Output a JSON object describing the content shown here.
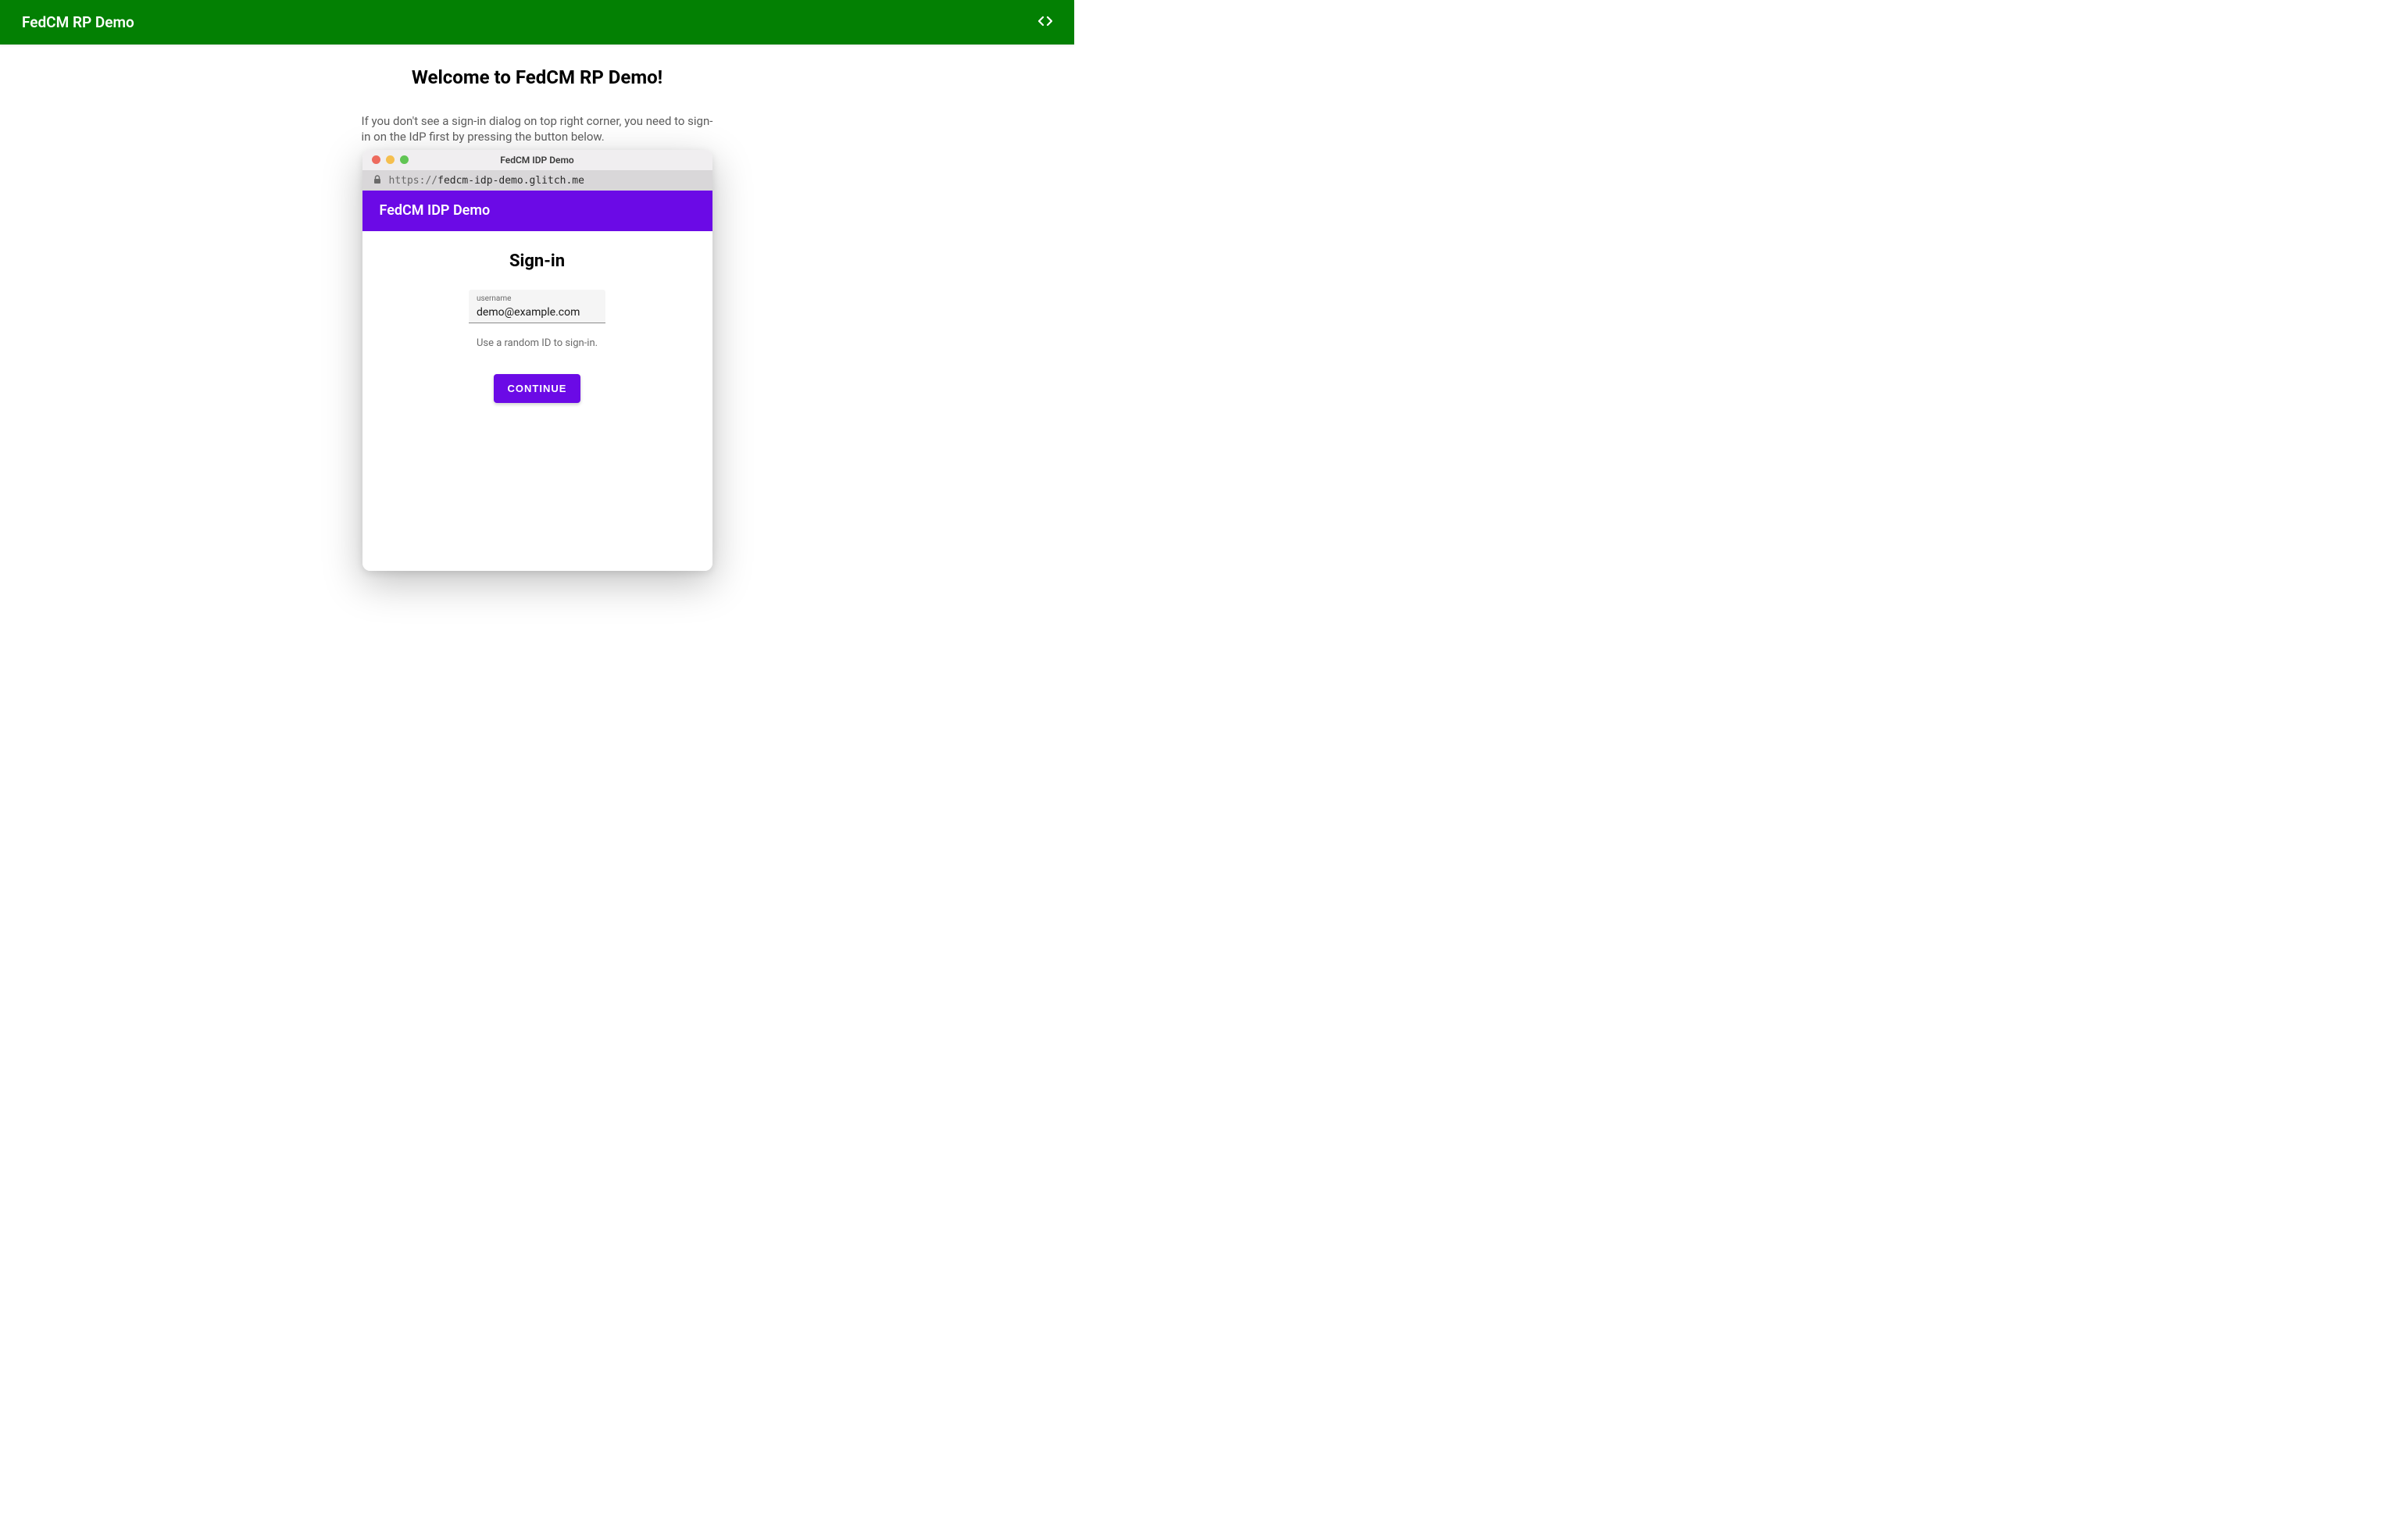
{
  "header": {
    "title": "FedCM RP Demo"
  },
  "main": {
    "title": "Welcome to FedCM RP Demo!",
    "instruction": "If you don't see a sign-in dialog on top right corner, you need to sign-in on the IdP first by pressing the button below."
  },
  "popup": {
    "window_title": "FedCM IDP Demo",
    "url_prefix": "https://",
    "url_host": "fedcm-idp-demo.glitch.me",
    "idp_header": "FedCM IDP Demo",
    "signin_title": "Sign-in",
    "username_label": "username",
    "username_value": "demo@example.com",
    "helper_text": "Use a random ID to sign-in.",
    "continue_button": "CONTINUE"
  }
}
